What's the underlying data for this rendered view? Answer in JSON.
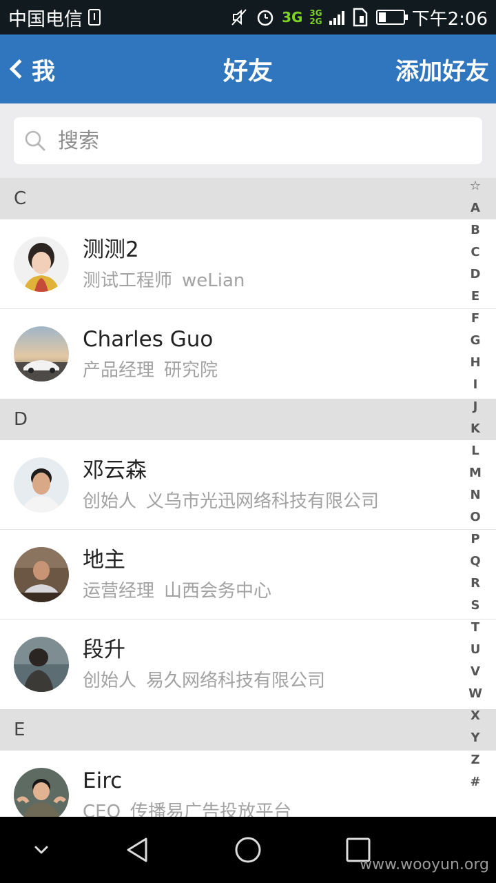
{
  "status_bar": {
    "carrier": "中国电信",
    "network_main": "3G",
    "network_top": "3G",
    "network_bottom": "2G",
    "battery_level": 0.3,
    "time": "下午2:06"
  },
  "nav": {
    "back_label": "我",
    "title": "好友",
    "action_label": "添加好友"
  },
  "search": {
    "placeholder": "搜索"
  },
  "sections": [
    {
      "letter": "C",
      "contacts": [
        {
          "name": "测测2",
          "title": "测试工程师",
          "company": "weLian",
          "avatar": "avatar-woman"
        },
        {
          "name": "Charles Guo",
          "title": "产品经理",
          "company": "研究院",
          "avatar": "avatar-car"
        }
      ]
    },
    {
      "letter": "D",
      "contacts": [
        {
          "name": "邓云森",
          "title": "创始人",
          "company": "义乌市光迅网络科技有限公司",
          "avatar": "avatar-man"
        },
        {
          "name": "地主",
          "title": "运营经理",
          "company": "山西会务中心",
          "avatar": "avatar-man-office"
        },
        {
          "name": "段升",
          "title": "创始人",
          "company": "易久网络科技有限公司",
          "avatar": "avatar-sea"
        }
      ]
    },
    {
      "letter": "E",
      "contacts": [
        {
          "name": "Eirc",
          "title": "CEO",
          "company": "传播易广告投放平台",
          "avatar": "avatar-child"
        }
      ]
    }
  ],
  "index_letters": [
    "☆",
    "A",
    "B",
    "C",
    "D",
    "E",
    "F",
    "G",
    "H",
    "I",
    "J",
    "K",
    "L",
    "M",
    "N",
    "O",
    "P",
    "Q",
    "R",
    "S",
    "T",
    "U",
    "V",
    "W",
    "X",
    "Y",
    "Z",
    "#"
  ],
  "watermark": "www.wooyun.org",
  "colors": {
    "nav_bar": "#2f76be",
    "status_bar": "#111a1f",
    "section_header": "#e0e0e0",
    "network_green": "#7ed321"
  }
}
